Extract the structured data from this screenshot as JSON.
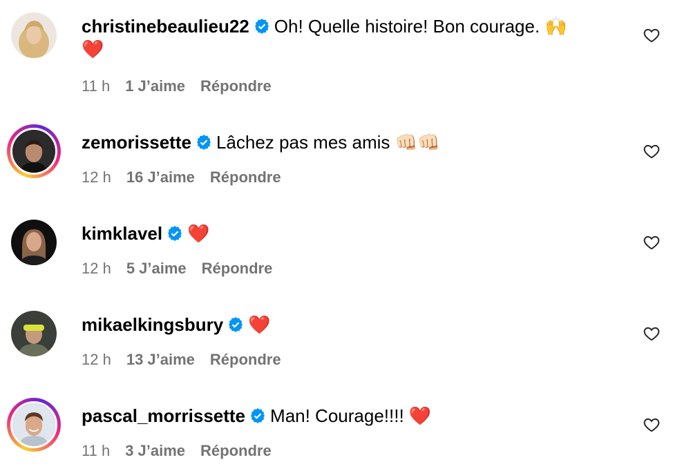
{
  "comments": [
    {
      "username": "christinebeaulieu22",
      "text": "Oh! Quelle histoire! Bon courage.",
      "emoji": "🙌",
      "line2": "❤️",
      "time": "11 h",
      "likes": "1 J’aime",
      "reply": "Répondre"
    },
    {
      "username": "zemorissette",
      "text": "Lâchez pas mes amis",
      "emoji": "👊🏻👊🏻",
      "line2": "",
      "time": "12 h",
      "likes": "16 J’aime",
      "reply": "Répondre"
    },
    {
      "username": "kimklavel",
      "text": "",
      "emoji": "❤️",
      "line2": "",
      "time": "12 h",
      "likes": "5 J’aime",
      "reply": "Répondre"
    },
    {
      "username": "mikaelkingsbury",
      "text": "",
      "emoji": "❤️",
      "line2": "",
      "time": "12 h",
      "likes": "13 J’aime",
      "reply": "Répondre"
    },
    {
      "username": "pascal_morrissette",
      "text": "Man! Courage!!!!",
      "emoji": "❤️",
      "line2": "",
      "time": "11 h",
      "likes": "3 J’aime",
      "reply": "Répondre"
    }
  ],
  "colors": {
    "verified": "#0095f6",
    "meta": "#737373"
  }
}
